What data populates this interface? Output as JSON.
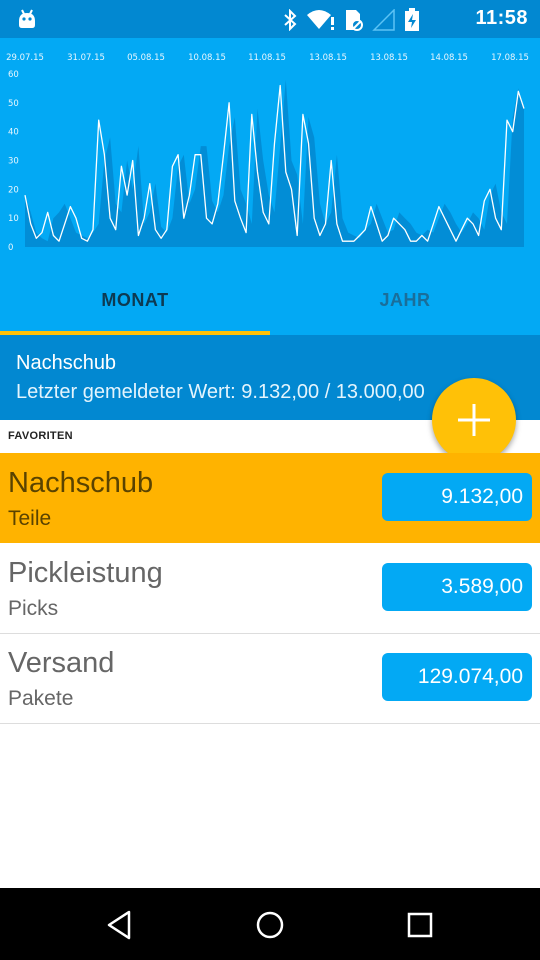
{
  "status_bar": {
    "time": "11:58",
    "icons": [
      "android-icon",
      "bluetooth-icon",
      "wifi-icon",
      "sim-alert-icon",
      "signal-icon",
      "battery-charging-icon"
    ]
  },
  "chart_data": {
    "type": "area",
    "title": "",
    "xlabel": "",
    "ylabel": "",
    "x_ticks": [
      "29.07.15",
      "31.07.15",
      "05.08.15",
      "10.08.15",
      "11.08.15",
      "13.08.15",
      "13.08.15",
      "14.08.15",
      "17.08.15"
    ],
    "y_ticks": [
      0,
      10,
      20,
      30,
      40,
      50,
      60
    ],
    "ylim": [
      0,
      60
    ],
    "grid": false,
    "series": [
      {
        "fill_values": [
          18,
          12,
          5,
          3,
          2,
          10,
          12,
          15,
          10,
          5,
          4,
          3,
          5,
          8,
          30,
          38,
          15,
          12,
          30,
          20,
          35,
          8,
          12,
          22,
          7,
          5,
          10,
          28,
          32,
          15,
          20,
          35,
          35,
          16,
          12,
          18,
          35,
          45,
          20,
          15,
          8,
          48,
          30,
          18,
          12,
          35,
          58,
          30,
          25,
          8,
          45,
          38,
          15,
          8,
          12,
          32,
          10,
          5,
          4,
          3,
          6,
          8,
          15,
          10,
          5,
          6,
          12,
          10,
          8,
          5,
          4,
          6,
          5,
          10,
          15,
          12,
          8,
          5,
          8,
          12,
          10,
          6,
          18,
          22,
          12,
          8,
          45,
          55,
          48
        ],
        "line_values": [
          18,
          8,
          3,
          5,
          12,
          4,
          2,
          8,
          14,
          10,
          3,
          2,
          6,
          44,
          32,
          10,
          6,
          28,
          18,
          30,
          4,
          10,
          22,
          6,
          3,
          6,
          28,
          32,
          10,
          18,
          32,
          32,
          10,
          8,
          15,
          32,
          50,
          16,
          10,
          5,
          46,
          26,
          12,
          8,
          36,
          56,
          26,
          20,
          4,
          46,
          36,
          10,
          4,
          8,
          30,
          8,
          2,
          2,
          2,
          4,
          6,
          14,
          8,
          2,
          4,
          10,
          8,
          6,
          2,
          2,
          4,
          2,
          8,
          14,
          10,
          6,
          2,
          6,
          10,
          8,
          4,
          16,
          20,
          10,
          6,
          44,
          40,
          54,
          48
        ]
      }
    ]
  },
  "tabs": [
    {
      "label": "MONAT",
      "active": true
    },
    {
      "label": "JAHR",
      "active": false
    }
  ],
  "summary": {
    "title": "Nachschub",
    "subtitle": "Letzter gemeldeter Wert: 9.132,00 / 13.000,00"
  },
  "fab": {
    "icon": "plus-icon"
  },
  "favorites": {
    "header": "FAVORITEN",
    "items": [
      {
        "name": "Nachschub",
        "unit": "Teile",
        "value": "9.132,00",
        "highlighted": true
      },
      {
        "name": "Pickleistung",
        "unit": "Picks",
        "value": "3.589,00",
        "highlighted": false
      },
      {
        "name": "Versand",
        "unit": "Pakete",
        "value": "129.074,00",
        "highlighted": false
      }
    ]
  },
  "colors": {
    "primary": "#03a9f4",
    "primary_dark": "#0288d1",
    "accent": "#ffc107",
    "highlight_row": "#ffb300"
  },
  "nav": {
    "icons": [
      "back-icon",
      "home-icon",
      "recents-icon"
    ]
  }
}
